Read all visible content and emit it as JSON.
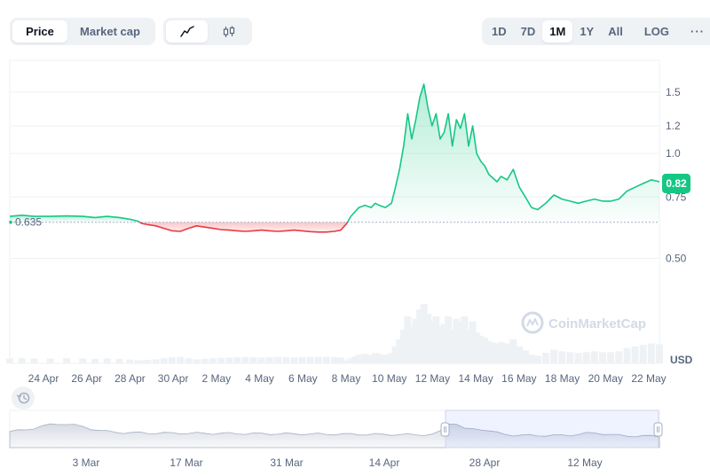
{
  "metric_toggle": {
    "options": [
      "Price",
      "Market cap"
    ],
    "active": "Price"
  },
  "type_toggle": {
    "line_icon": "line-chart-icon",
    "candle_icon": "candlestick-icon",
    "active": "line"
  },
  "range_toggle": {
    "options": [
      "1D",
      "7D",
      "1M",
      "1Y",
      "All"
    ],
    "active": "1M",
    "log_label": "LOG",
    "more_label": "···"
  },
  "watermark": "CoinMarketCap",
  "history_icon": "history-icon",
  "colors": {
    "up": "#16c784",
    "down": "#ea3943",
    "grid": "#eff2f5",
    "baseline": "#a6b0c3"
  },
  "chart_data": [
    {
      "type": "line",
      "xlabels": [
        "24 Apr",
        "26 Apr",
        "28 Apr",
        "30 Apr",
        "2 May",
        "4 May",
        "6 May",
        "8 May",
        "10 May",
        "12 May",
        "14 May",
        "16 May",
        "18 May",
        "20 May",
        "22 May"
      ],
      "yticks": [
        "1.5",
        "1.2",
        "1.0",
        "0.75",
        "0.50"
      ],
      "ylabel": "USD",
      "ylim": [
        0.25,
        1.85
      ],
      "baseline_value": 0.635,
      "baseline_label": "0.635",
      "current_value": 0.82,
      "current_label": "0.82",
      "y_scale": "log",
      "series": [
        {
          "x": [
            0,
            0.6,
            1.2,
            2.0,
            2.8,
            3.6,
            4.2,
            4.8,
            5.4,
            5.9,
            6.3,
            6.5,
            6.8,
            7.2,
            7.6,
            8.0,
            8.4,
            8.8,
            9.2,
            9.6,
            10.0,
            10.4,
            10.8,
            11.2,
            11.6,
            12.0,
            12.4,
            12.8,
            13.2,
            13.6,
            14.0,
            14.4,
            14.8,
            15.2,
            15.6,
            16.0,
            16.3,
            16.6,
            16.8,
            17.0,
            17.2,
            17.5,
            17.8,
            18.0,
            18.2,
            18.5,
            18.8,
            19.0,
            19.2,
            19.4,
            19.6,
            19.8,
            20.0,
            20.2,
            20.4,
            20.6,
            20.8,
            21.0,
            21.2,
            21.4,
            21.6,
            21.8,
            22.0,
            22.2,
            22.4,
            22.6,
            22.8,
            23.0,
            23.2,
            23.4,
            23.6,
            23.8,
            24.0,
            24.2,
            24.5,
            24.8,
            25.1,
            25.4,
            25.7,
            26.0,
            26.4,
            26.8,
            27.2,
            27.6,
            28.0,
            28.4,
            28.8,
            29.2,
            29.6,
            30.0,
            30.4,
            30.8,
            31.2,
            31.6,
            32.0
          ],
          "y": [
            0.66,
            0.665,
            0.66,
            0.66,
            0.662,
            0.66,
            0.655,
            0.66,
            0.655,
            0.648,
            0.64,
            0.63,
            0.625,
            0.62,
            0.61,
            0.6,
            0.598,
            0.61,
            0.62,
            0.615,
            0.61,
            0.605,
            0.603,
            0.6,
            0.598,
            0.6,
            0.603,
            0.6,
            0.598,
            0.6,
            0.603,
            0.6,
            0.597,
            0.595,
            0.595,
            0.598,
            0.603,
            0.63,
            0.66,
            0.68,
            0.7,
            0.71,
            0.7,
            0.72,
            0.71,
            0.7,
            0.72,
            0.8,
            0.9,
            1.05,
            1.3,
            1.1,
            1.25,
            1.45,
            1.58,
            1.35,
            1.2,
            1.3,
            1.1,
            1.15,
            1.3,
            1.05,
            1.25,
            1.18,
            1.3,
            1.05,
            1.2,
            1.0,
            0.95,
            0.92,
            0.87,
            0.85,
            0.83,
            0.86,
            0.84,
            0.9,
            0.8,
            0.75,
            0.7,
            0.69,
            0.72,
            0.76,
            0.74,
            0.73,
            0.72,
            0.73,
            0.74,
            0.73,
            0.73,
            0.74,
            0.78,
            0.8,
            0.82,
            0.84,
            0.83
          ]
        }
      ]
    },
    {
      "type": "area",
      "role": "navigator",
      "xlabels": [
        "3 Mar",
        "17 Mar",
        "31 Mar",
        "14 Apr",
        "28 Apr",
        "12 May"
      ],
      "selection_start_label": "24 Apr",
      "selection_end_label": "22 May"
    }
  ]
}
